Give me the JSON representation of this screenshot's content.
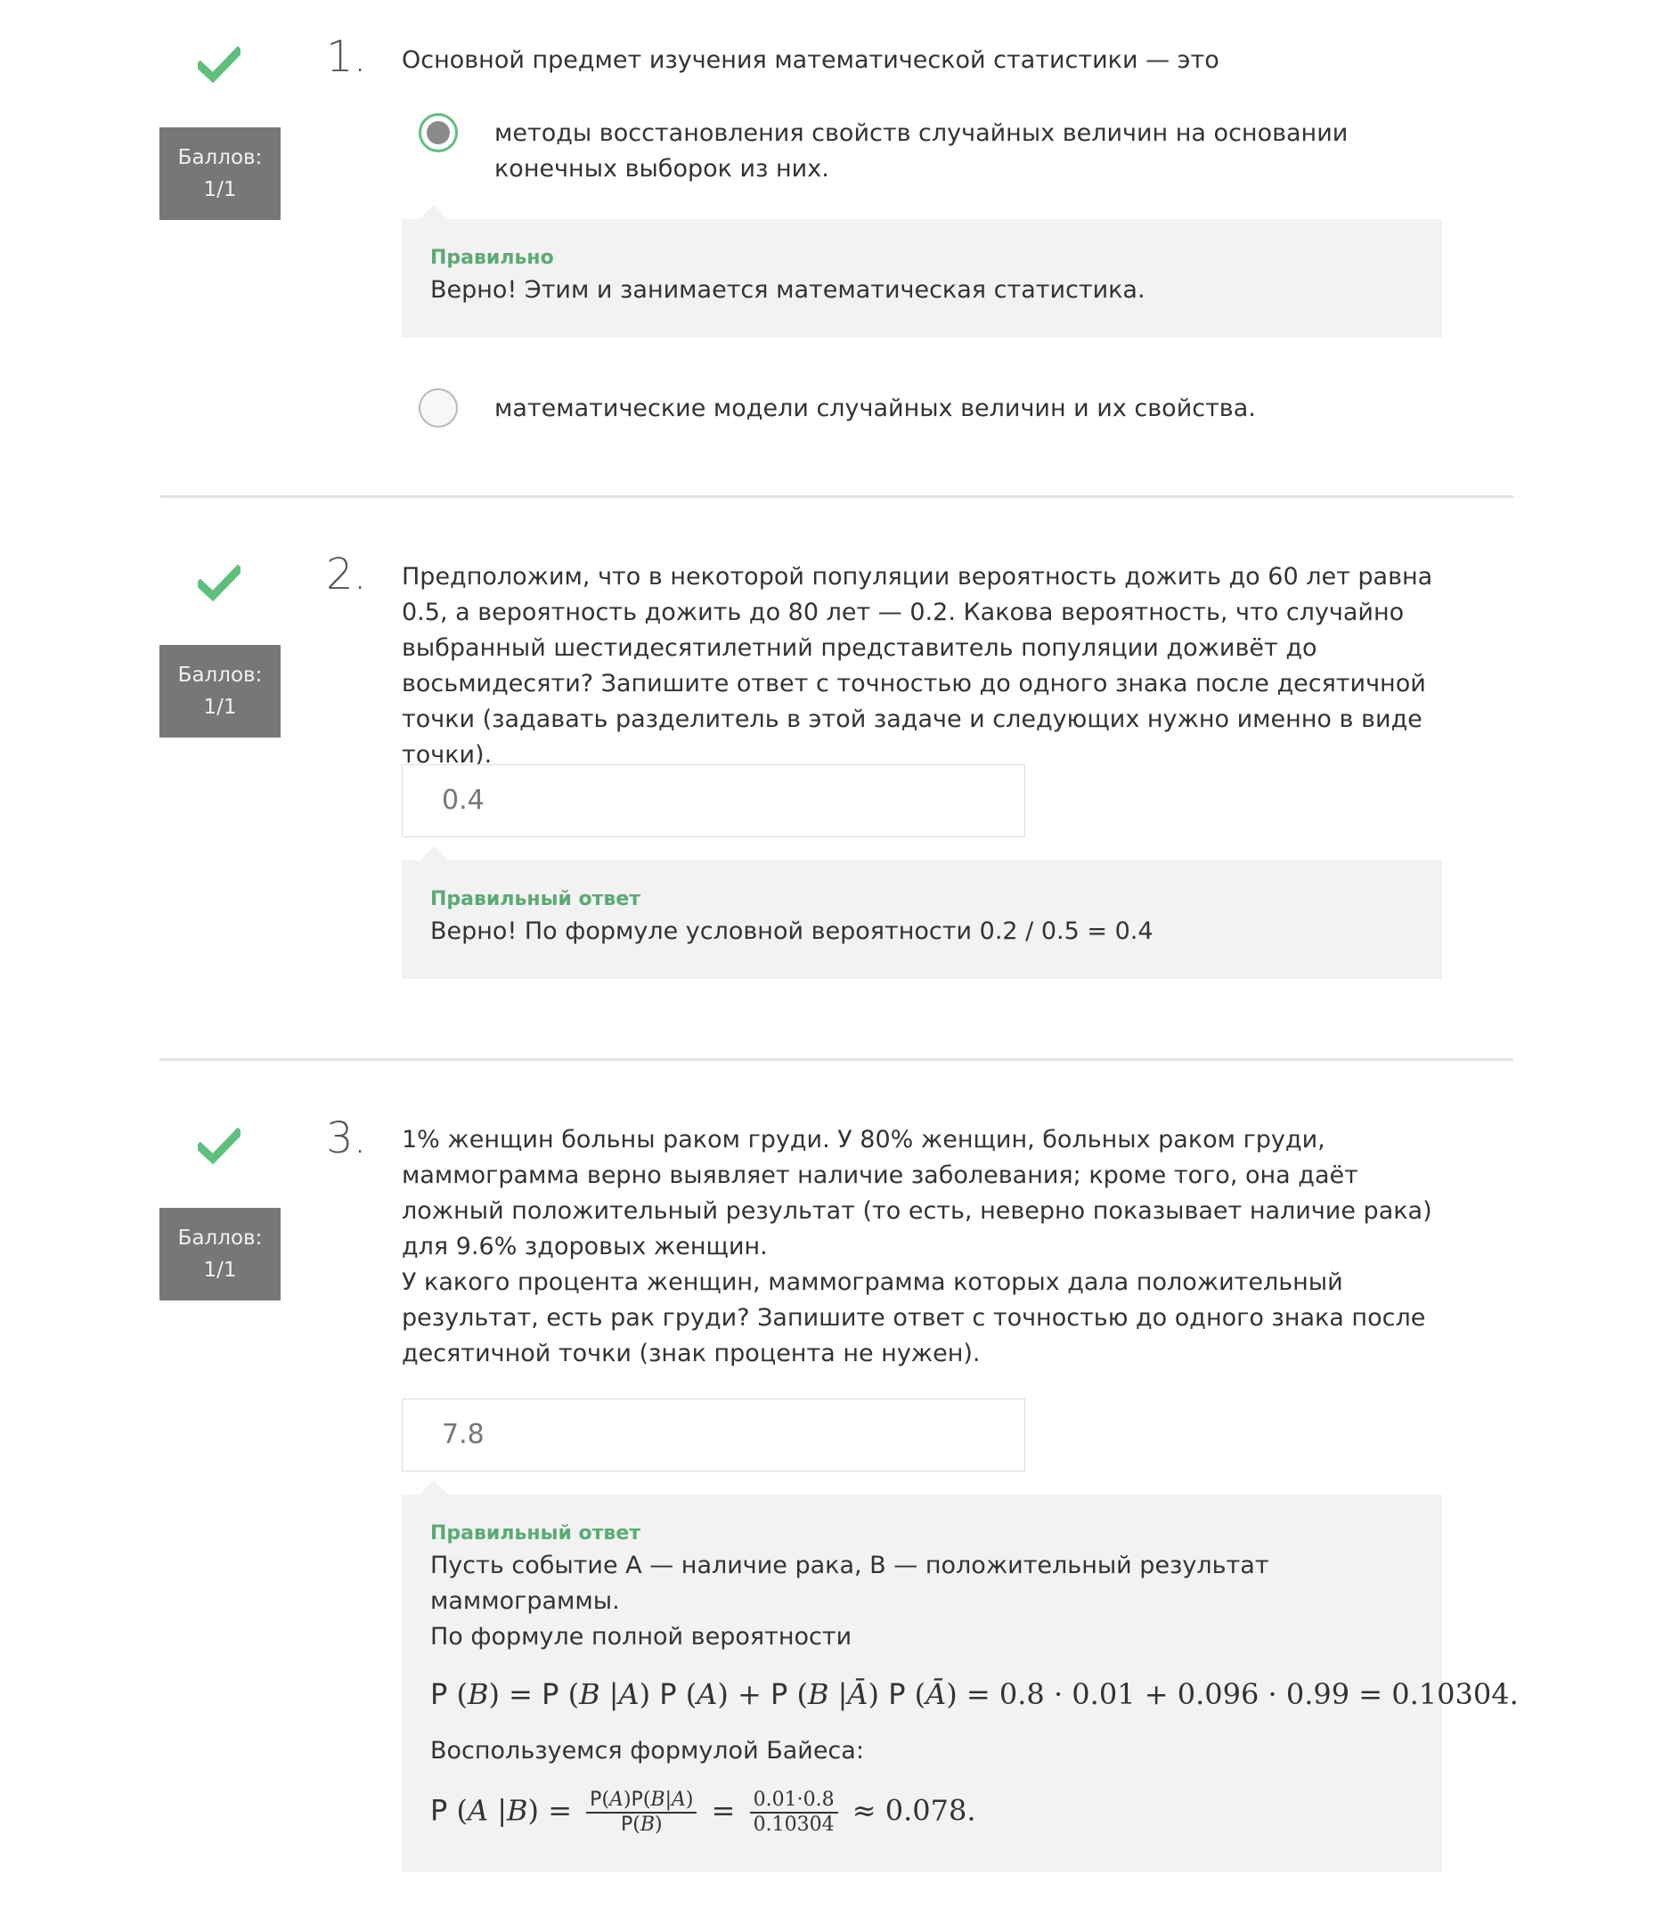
{
  "problems": [
    {
      "number": "1.",
      "score_label": "Баллов:",
      "score_value": "1/1",
      "question": "Основной предмет изучения математической статистики — это",
      "options": [
        {
          "label": "методы восстановления свойств случайных величин на основании конечных выборок из них.",
          "selected": true
        },
        {
          "label": "математические модели случайных величин и их свойства.",
          "selected": false
        }
      ],
      "feedback_title": "Правильно",
      "feedback_text": "Верно! Этим и занимается математическая статистика."
    },
    {
      "number": "2.",
      "score_label": "Баллов:",
      "score_value": "1/1",
      "question": "Предположим, что в некоторой популяции вероятность дожить до 60 лет равна 0.5, а вероятность дожить до 80 лет — 0.2. Какова вероятность, что случайно выбранный шестидесятилетний представитель популяции доживёт до восьмидесяти? Запишите ответ с точностью до одного знака после десятичной точки (задавать разделитель в этой задаче и следующих нужно именно в виде точки).",
      "answer_value": "0.4",
      "feedback_title": "Правильный ответ",
      "feedback_text": "Верно! По формуле условной вероятности 0.2 / 0.5 = 0.4"
    },
    {
      "number": "3.",
      "score_label": "Баллов:",
      "score_value": "1/1",
      "question_p1": "1% женщин больны раком груди. У 80% женщин, больных раком груди, маммограмма верно выявляет наличие заболевания; кроме того, она даёт ложный положительный результат (то есть, неверно показывает наличие рака) для 9.6% здоровых женщин.",
      "question_p2": "У какого процента женщин, маммограмма которых дала положительный результат, есть рак груди? Запишите ответ с точностью до одного знака после десятичной точки (знак процента не нужен).",
      "answer_value": "7.8",
      "feedback_title": "Правильный ответ",
      "feedback_line1": "Пусть событие A — наличие рака, B — положительный результат маммограммы.",
      "feedback_line2": "По формуле полной вероятности",
      "formula1_rhs": "= 0.8 · 0.01 + 0.096 · 0.99 = 0.10304.",
      "feedback_line3": "Воспользуемся формулой Байеса:",
      "formula2_frac2_top": "0.01·0.8",
      "formula2_frac2_bot": "0.10304",
      "formula2_result": "≈ 0.078."
    }
  ],
  "colors": {
    "check": "#5fbf7d",
    "score_bg": "#777777",
    "feedback_bg": "#f2f2f2",
    "feedback_title": "#5aab73"
  },
  "icons": {
    "status": "checkmark-icon"
  }
}
